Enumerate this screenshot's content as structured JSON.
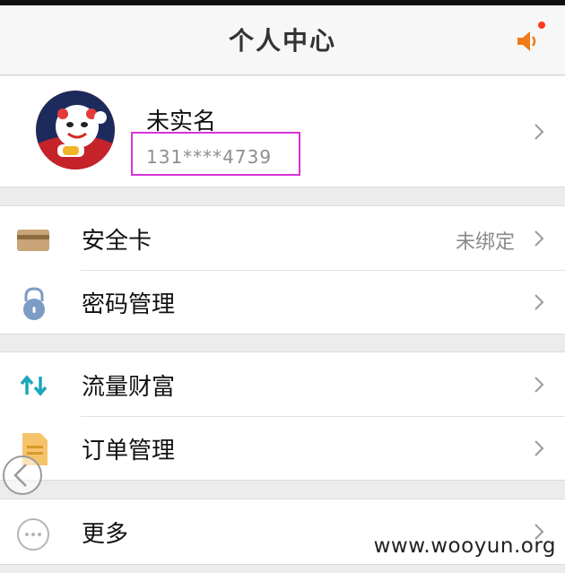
{
  "header": {
    "title": "个人中心"
  },
  "profile": {
    "name": "未实名",
    "phone": "131****4739"
  },
  "groups": [
    {
      "items": [
        {
          "label": "安全卡",
          "value": "未绑定"
        },
        {
          "label": "密码管理"
        }
      ]
    },
    {
      "items": [
        {
          "label": "流量财富"
        },
        {
          "label": "订单管理"
        }
      ]
    },
    {
      "items": [
        {
          "label": "更多"
        }
      ]
    }
  ],
  "watermark": "www.wooyun.org",
  "icons": {
    "card": "bank-card-icon",
    "lock": "lock-icon",
    "traffic": "up-down-arrows-icon",
    "order": "document-icon",
    "more": "more-dots-icon",
    "speaker": "speaker-icon"
  },
  "colors": {
    "accent": "#f07a1a",
    "highlight_box": "#d633d6",
    "teal": "#1aa7b8"
  }
}
